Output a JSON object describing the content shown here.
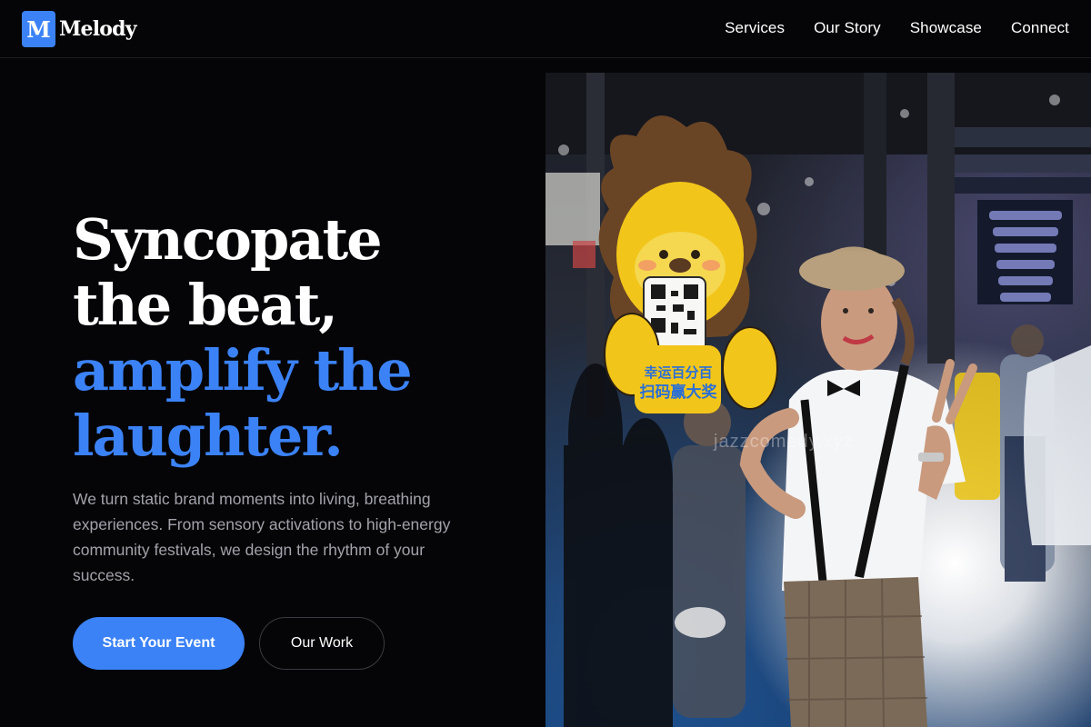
{
  "brand": {
    "badge": "M",
    "name": "Melody",
    "accent_color": "#3b82f6"
  },
  "nav": {
    "items": [
      {
        "label": "Services"
      },
      {
        "label": "Our Story"
      },
      {
        "label": "Showcase"
      },
      {
        "label": "Connect"
      }
    ]
  },
  "hero": {
    "headline_line1": "Syncopate",
    "headline_line2": "the beat,",
    "headline_line3": "amplify the",
    "headline_line4": "laughter.",
    "subtext": "We turn static brand moments into living, breathing experiences. From sensory activations to high-energy community festivals, we design the rhythm of your success.",
    "primary_cta": "Start Your Event",
    "secondary_cta": "Our Work"
  },
  "image": {
    "watermark": "jazzcomedy.xyz",
    "sign_text": "幸运百分百 扫码赢大奖"
  }
}
